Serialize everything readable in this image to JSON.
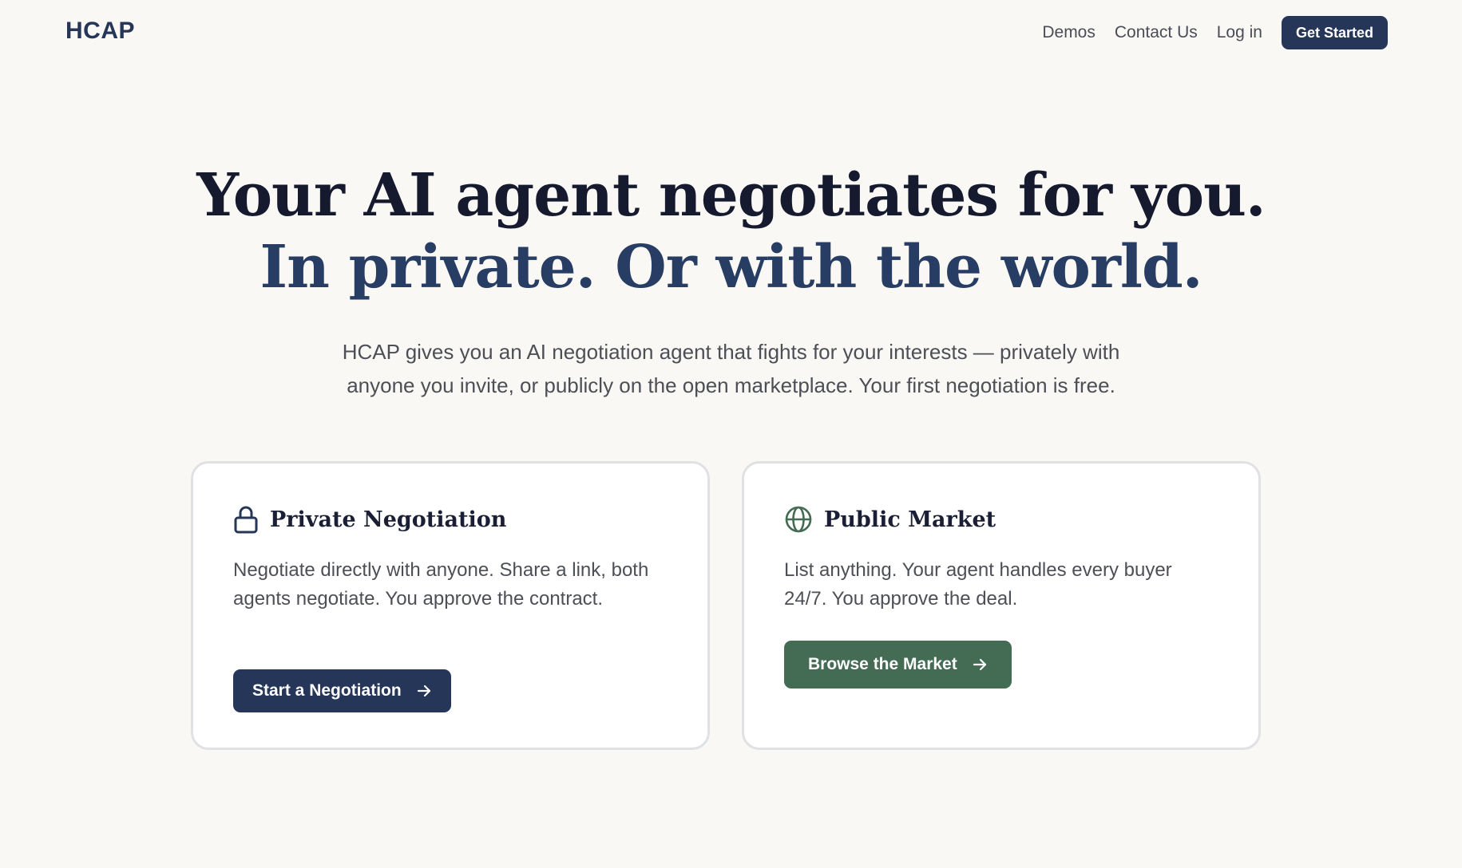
{
  "nav": {
    "logo": "HCAP",
    "links": [
      "Demos",
      "Contact Us",
      "Log in"
    ],
    "cta": "Get Started"
  },
  "hero": {
    "line1": "Your AI agent negotiates for you.",
    "line2": "In private. Or with the world.",
    "subtitle_line1": "HCAP gives you an AI negotiation agent that fights for your interests — privately with",
    "subtitle_line2": "anyone you invite, or publicly on the open marketplace. Your first negotiation is free."
  },
  "cards": [
    {
      "icon": "lock-icon",
      "title": "Private Negotiation",
      "description": "Negotiate directly with anyone. Share a link, both agents negotiate. You approve the contract.",
      "button": "Start a Negotiation",
      "button_color": "#253659"
    },
    {
      "icon": "globe-icon",
      "title": "Public Market",
      "description": "List anything. Your agent handles every buyer 24/7. You approve the deal.",
      "button": "Browse the Market",
      "button_color": "#446b53"
    }
  ],
  "colors": {
    "background": "#f9f8f4",
    "brand_navy": "#253659",
    "brand_green": "#446b53"
  }
}
